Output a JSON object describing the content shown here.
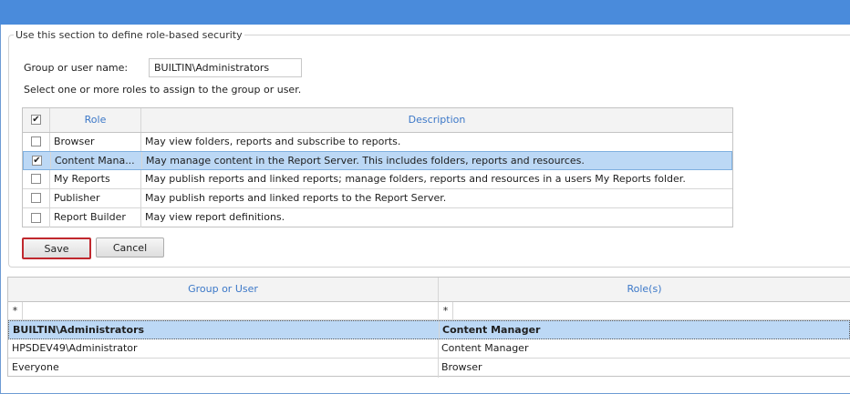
{
  "section_legend": "Use this section to define role-based security",
  "group_user": {
    "label": "Group or user name:",
    "value": "BUILTIN\\Administrators"
  },
  "select_prompt": "Select one or more roles to assign to the group or user.",
  "roles_table": {
    "headers": {
      "role": "Role",
      "description": "Description"
    },
    "rows": [
      {
        "role": "Browser",
        "description": "May view folders, reports and subscribe to reports.",
        "checked": false
      },
      {
        "role": "Content Mana...",
        "description": "May manage content in the Report Server.  This includes folders, reports and resources.",
        "checked": true
      },
      {
        "role": "My Reports",
        "description": "May publish reports and linked reports; manage folders, reports and resources in a users My Reports folder.",
        "checked": false
      },
      {
        "role": "Publisher",
        "description": "May publish reports and linked reports to the Report Server.",
        "checked": false
      },
      {
        "role": "Report Builder",
        "description": "May view report definitions.",
        "checked": false
      }
    ]
  },
  "buttons": {
    "save": "Save",
    "cancel": "Cancel"
  },
  "assignments_table": {
    "headers": {
      "group": "Group or User",
      "roles": "Role(s)"
    },
    "filter": {
      "group": "*",
      "roles": "*"
    },
    "rows": [
      {
        "group": "BUILTIN\\Administrators",
        "roles": "Content Manager",
        "selected": true
      },
      {
        "group": "HPSDEV49\\Administrator",
        "roles": "Content Manager",
        "selected": false
      },
      {
        "group": "Everyone",
        "roles": "Browser",
        "selected": false
      }
    ]
  },
  "check_glyph": "✔",
  "colors": {
    "titlebar": "#4a8bdb",
    "header_text": "#3c78c8",
    "selection": "#bcd8f5",
    "save_border": "#c0282e"
  }
}
